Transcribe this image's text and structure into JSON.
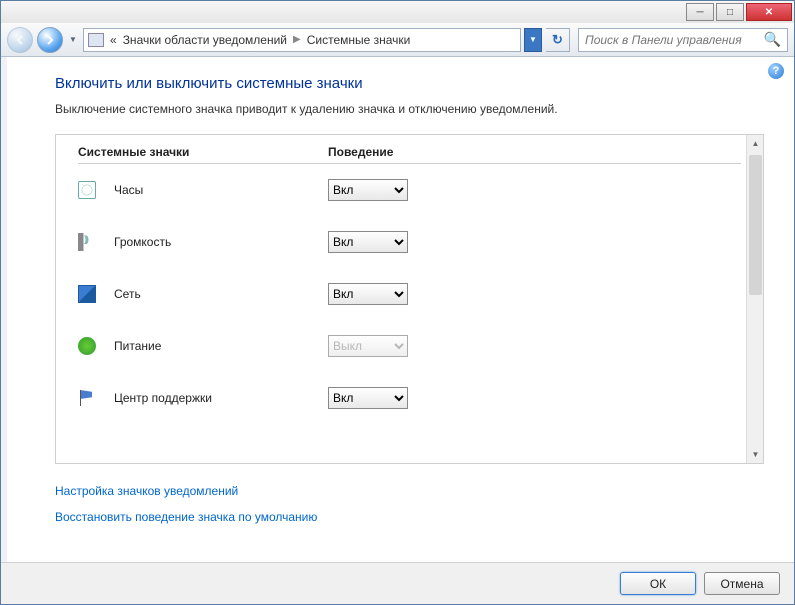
{
  "breadcrumb": {
    "prefix": "«",
    "part1": "Значки области уведомлений",
    "part2": "Системные значки"
  },
  "search": {
    "placeholder": "Поиск в Панели управления"
  },
  "page": {
    "title": "Включить или выключить системные значки",
    "description": "Выключение системного значка приводит к удалению значка и отключению уведомлений."
  },
  "columns": {
    "icons": "Системные значки",
    "behavior": "Поведение"
  },
  "options": {
    "on": "Вкл",
    "off": "Выкл"
  },
  "rows": [
    {
      "label": "Часы",
      "value": "Вкл",
      "enabled": true,
      "icon": "clock"
    },
    {
      "label": "Громкость",
      "value": "Вкл",
      "enabled": true,
      "icon": "vol"
    },
    {
      "label": "Сеть",
      "value": "Вкл",
      "enabled": true,
      "icon": "net"
    },
    {
      "label": "Питание",
      "value": "Выкл",
      "enabled": false,
      "icon": "pwr"
    },
    {
      "label": "Центр поддержки",
      "value": "Вкл",
      "enabled": true,
      "icon": "flag"
    }
  ],
  "links": {
    "customize": "Настройка значков уведомлений",
    "restore": "Восстановить поведение значка по умолчанию"
  },
  "buttons": {
    "ok": "ОК",
    "cancel": "Отмена"
  }
}
